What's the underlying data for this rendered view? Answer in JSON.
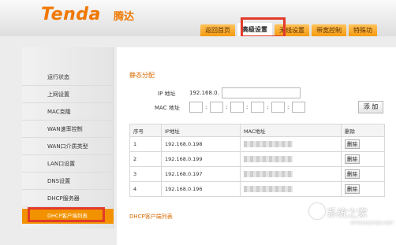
{
  "brand": {
    "logo": "Tenda",
    "logo_cn": "腾达"
  },
  "tabs": [
    {
      "label": "返回首页"
    },
    {
      "label": "高级设置"
    },
    {
      "label": "无线设置"
    },
    {
      "label": "带宽控制"
    },
    {
      "label": "特殊功"
    }
  ],
  "sidebar": {
    "items": [
      {
        "label": "运行状态"
      },
      {
        "label": "上网设置"
      },
      {
        "label": "MAC克隆"
      },
      {
        "label": "WAN速率控制"
      },
      {
        "label": "WAN口介质类型"
      },
      {
        "label": "LAN口设置"
      },
      {
        "label": "DNS设置"
      },
      {
        "label": "DHCP服务器"
      },
      {
        "label": "DHCP客户端列表"
      }
    ]
  },
  "static": {
    "title": "静态分配",
    "ip_label": "IP 地址",
    "ip_prefix": "192.168.0.",
    "mac_label": "MAC 地址",
    "add_button": "添 加"
  },
  "table": {
    "headers": [
      "序号",
      "IP地址",
      "MAC地址",
      "删除"
    ],
    "rows": [
      {
        "no": "1",
        "ip": "192.168.0.198",
        "delete": "删除"
      },
      {
        "no": "2",
        "ip": "192.168.0.199",
        "delete": "删除"
      },
      {
        "no": "3",
        "ip": "192.168.0.197",
        "delete": "删除"
      },
      {
        "no": "4",
        "ip": "192.168.0.196",
        "delete": "删除"
      }
    ]
  },
  "client_list": {
    "title": "DHCP客户端列表"
  },
  "watermark": {
    "text": "系统之家",
    "sub": "XITONGZHIJIA.NET"
  },
  "colors": {
    "accent": "#f07800",
    "tab": "#f59a10",
    "highlight": "#e23a2a"
  }
}
